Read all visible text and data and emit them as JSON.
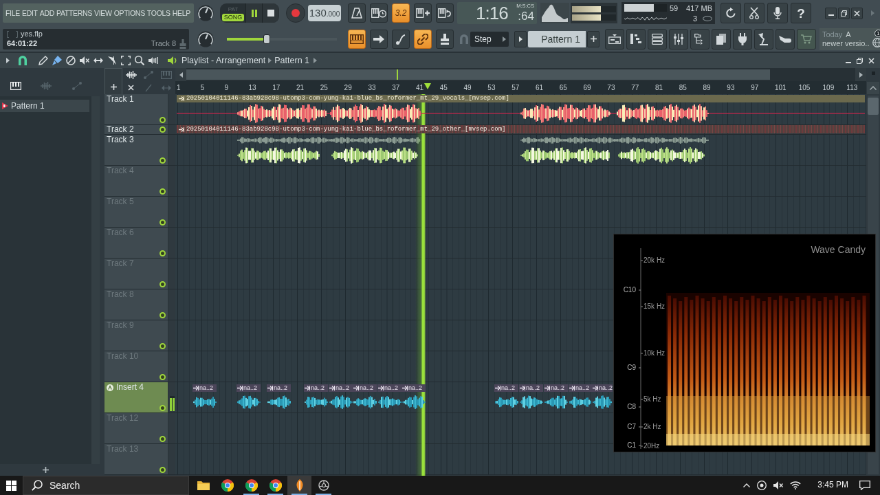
{
  "menu": [
    "FILE",
    "EDIT",
    "ADD",
    "PATTERNS",
    "VIEW",
    "OPTIONS",
    "TOOLS",
    "HELP"
  ],
  "hint_panel": {
    "file": "yes.flp",
    "time": "64:01:22",
    "track": "Track 8"
  },
  "transport": {
    "modes": [
      {
        "label": "PAT",
        "selected": false
      },
      {
        "label": "SONG",
        "selected": true
      }
    ],
    "playing": true,
    "tempo": "130",
    "tempo_fraction": ".000"
  },
  "master_volume": {
    "level": 0.36
  },
  "tool_buttons": [
    {
      "on": false
    },
    {
      "on": false
    },
    {
      "on": true,
      "label": "3.2"
    },
    {
      "on": false
    },
    {
      "on": false
    },
    {
      "on": true
    },
    {
      "on": false
    },
    {
      "on": false
    },
    {
      "on": true
    },
    {
      "on": false
    }
  ],
  "time_display": {
    "value": "1:16",
    "fraction": ":64",
    "format": "M:S:CS"
  },
  "peak_meters": [
    {
      "level": 0.65
    },
    {
      "level": 0.65
    }
  ],
  "cpu_panel": {
    "level": 0.7,
    "polyphony": "59",
    "memory": "417 MB",
    "count": "3"
  },
  "help_button": "?",
  "pattern_bar": {
    "snap": "Step",
    "pattern": "Pattern 1"
  },
  "news": {
    "date": "Today",
    "headline": "A",
    "text": "newer versio..",
    "badge": "1"
  },
  "playlist": {
    "title": "Playlist - Arrangement",
    "pattern": "Pattern 1",
    "picker": [
      {
        "label": "Pattern 1",
        "selected": true
      }
    ],
    "ruler": [
      "1",
      "5",
      "9",
      "13",
      "17",
      "21",
      "25",
      "29",
      "33",
      "37",
      "41",
      "45",
      "49",
      "53",
      "57",
      "61",
      "65",
      "69",
      "73",
      "77",
      "81",
      "85",
      "89",
      "93",
      "97",
      "101",
      "105",
      "109",
      "113"
    ],
    "tracks": [
      {
        "name": "Track 1",
        "kind": "normal",
        "dimmed": false,
        "enabled": true,
        "color": "#3f4a50",
        "clips": [
          {
            "kind": "titled",
            "title": "20250104011146-83ab928c98-utomp3-com-yung-kai-blue_bs_roformer_mt_29_vocals_[mvsep.com]"
          }
        ]
      },
      {
        "name": "Track 2",
        "kind": "thin",
        "dimmed": false,
        "enabled": true,
        "color": "#3f4a50",
        "clips": [
          {
            "kind": "strip",
            "title": "20250104011146-83ab928c98-utomp3-com-yung-kai-blue_bs_roformer_mt_29_other_[mvsep.com]"
          }
        ]
      },
      {
        "name": "Track 3",
        "kind": "normal",
        "dimmed": false,
        "enabled": true,
        "color": "#3f4a50",
        "clips": [
          {
            "kind": "wave"
          }
        ]
      },
      {
        "name": "Track 4",
        "kind": "normal",
        "dimmed": true,
        "enabled": true,
        "color": "#3f4a50"
      },
      {
        "name": "Track 5",
        "kind": "normal",
        "dimmed": true,
        "enabled": true,
        "color": "#3f4a50"
      },
      {
        "name": "Track 6",
        "kind": "normal",
        "dimmed": true,
        "enabled": true,
        "color": "#3f4a50"
      },
      {
        "name": "Track 7",
        "kind": "normal",
        "dimmed": true,
        "enabled": true,
        "color": "#3f4a50"
      },
      {
        "name": "Track 8",
        "kind": "normal",
        "dimmed": true,
        "enabled": true,
        "color": "#3f4a50"
      },
      {
        "name": "Track 9",
        "kind": "normal",
        "dimmed": true,
        "enabled": true,
        "color": "#3f4a50"
      },
      {
        "name": "Track 10",
        "kind": "normal",
        "dimmed": true,
        "enabled": true,
        "color": "#3f4a50"
      },
      {
        "name": "Insert 4",
        "kind": "audio",
        "dimmed": false,
        "enabled": true,
        "color": "#6e8b51",
        "meter": {
          "level": 0.85
        },
        "clips": [
          {
            "kind": "short",
            "title": "na..2"
          },
          {
            "kind": "short",
            "title": "na..2"
          },
          {
            "kind": "short",
            "title": "na..2"
          },
          {
            "kind": "short",
            "title": "na..2"
          },
          {
            "kind": "short",
            "title": "na..2"
          },
          {
            "kind": "short",
            "title": "na..2"
          },
          {
            "kind": "short",
            "title": "na..2"
          },
          {
            "kind": "short",
            "title": "na..2"
          },
          {
            "kind": "short",
            "title": "na..2"
          },
          {
            "kind": "short",
            "title": "na..2"
          },
          {
            "kind": "short",
            "title": "na..2"
          },
          {
            "kind": "short",
            "title": "na..2"
          },
          {
            "kind": "short",
            "title": "na..2"
          }
        ]
      },
      {
        "name": "Track 12",
        "kind": "normal",
        "dimmed": true,
        "enabled": true,
        "color": "#3f4a50"
      },
      {
        "name": "Track 13",
        "kind": "normal",
        "dimmed": true,
        "enabled": true,
        "color": "#3f4a50"
      }
    ]
  },
  "wave_candy": {
    "title": "Wave Candy",
    "notes": [
      "C10",
      "C9",
      "C8",
      "C7",
      "C1"
    ],
    "frequencies": [
      "20k Hz",
      "15k Hz",
      "10k Hz",
      "5k Hz",
      "2k Hz",
      "20Hz"
    ]
  },
  "taskbar": {
    "search": "Search",
    "apps": [
      {
        "running": false,
        "selected": false
      },
      {
        "running": false,
        "selected": false
      },
      {
        "running": true,
        "selected": false
      },
      {
        "running": true,
        "selected": false
      },
      {
        "running": true,
        "selected": true
      },
      {
        "running": true,
        "selected": false
      }
    ],
    "clock": "3:45 PM"
  }
}
